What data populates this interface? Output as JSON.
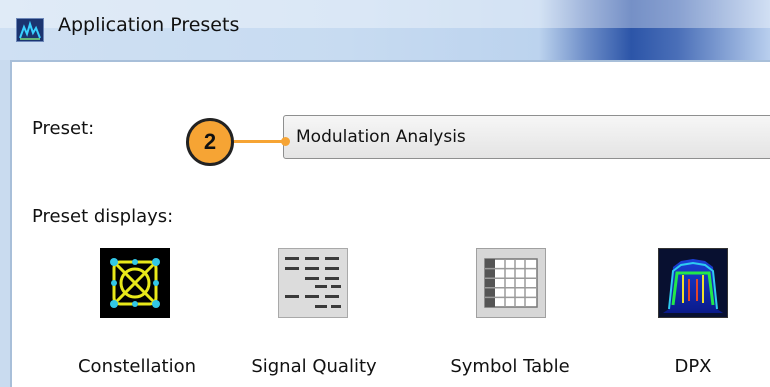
{
  "window": {
    "title": "Application Presets"
  },
  "preset": {
    "label": "Preset:",
    "value": "Modulation Analysis",
    "callout": "2"
  },
  "displays": {
    "label": "Preset displays:",
    "items": [
      {
        "label": "Constellation",
        "icon": "constellation-icon"
      },
      {
        "label": "Signal Quality",
        "icon": "signal-quality-icon"
      },
      {
        "label": "Symbol Table",
        "icon": "symbol-table-icon"
      },
      {
        "label": "DPX",
        "icon": "dpx-icon"
      }
    ]
  },
  "colors": {
    "callout": "#f6a434",
    "title_bar": "#c7dbf1"
  }
}
